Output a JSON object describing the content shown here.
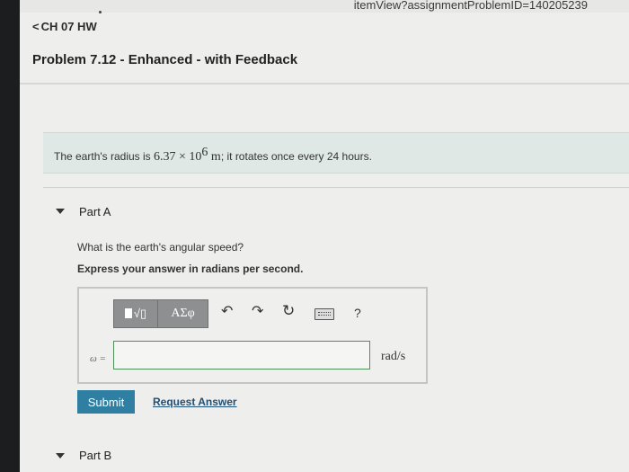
{
  "browser": {
    "url_tail": "itemView?assignmentProblemID=140205239"
  },
  "header": {
    "back_label": "CH 07 HW",
    "back_chevron": "chevron-left-icon",
    "problem_title": "Problem 7.12 - Enhanced - with Feedback"
  },
  "problem": {
    "intro_prefix": "The earth's radius is ",
    "intro_mantissa": "6.37",
    "intro_times": " × ",
    "intro_base": "10",
    "intro_exp": "6",
    "intro_unit": " m",
    "intro_suffix": "; it rotates once every 24 hours."
  },
  "parts": [
    {
      "label": "Part A",
      "question": "What is the earth's angular speed?",
      "instruction": "Express your answer in radians per second.",
      "toolbar": {
        "templates_label": "√▯",
        "symbols_label": "ΑΣφ",
        "undo_icon": "undo-icon",
        "redo_icon": "redo-icon",
        "reset_icon": "reset-icon",
        "keyboard_icon": "keyboard-icon",
        "help_label": "?"
      },
      "variable_label": "ω =",
      "answer_value": "",
      "unit": "rad/s",
      "submit_label": "Submit",
      "request_answer_label": "Request Answer"
    },
    {
      "label": "Part B"
    }
  ],
  "colors": {
    "submit_bg": "#2f7fa3",
    "prompt_bg": "#dfe8e4",
    "input_border": "#4f8f5a",
    "link": "#1f4f77"
  }
}
